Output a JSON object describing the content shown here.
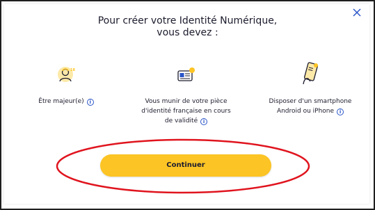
{
  "modal": {
    "title_line1": "Pour créer votre Identité Numérique,",
    "title_line2": "vous devez :",
    "close_label": "×"
  },
  "requirements": [
    {
      "icon": "adult-person-icon",
      "lines": [
        "Être majeur(e)"
      ]
    },
    {
      "icon": "id-card-icon",
      "lines": [
        "Vous munir de votre pièce",
        "d'identité française en cours",
        "de validité"
      ]
    },
    {
      "icon": "smartphone-icon",
      "lines": [
        "Disposer d'un smartphone",
        "Android ou iPhone"
      ]
    }
  ],
  "info_glyph": "i",
  "continue_button": {
    "label": "Continuer"
  },
  "colors": {
    "accent_yellow": "#fcc424",
    "info_blue": "#2a55c8",
    "close_blue": "#2a55c8",
    "annotation_red": "#e0141e",
    "text_dark": "#1c1c2e"
  }
}
